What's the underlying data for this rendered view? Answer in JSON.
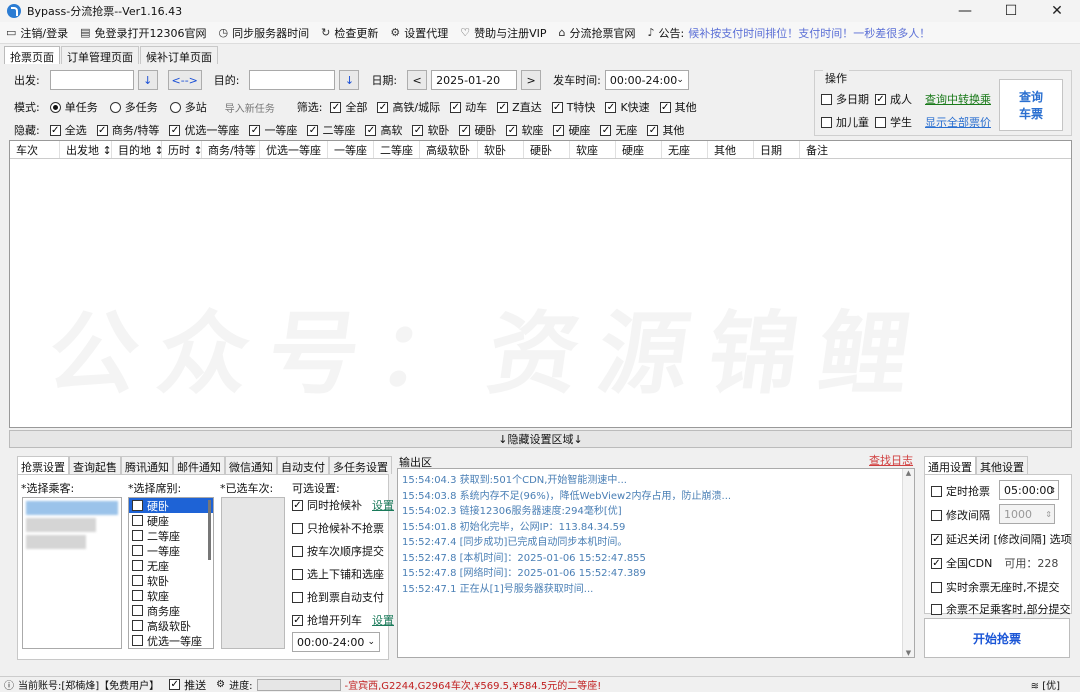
{
  "window": {
    "title": "Bypass-分流抢票--Ver1.16.43",
    "min": "—",
    "max": "☐",
    "close": "✕"
  },
  "menu": [
    {
      "icon": "▭",
      "label": "注销/登录"
    },
    {
      "icon": "▤",
      "label": "免登录打开12306官网"
    },
    {
      "icon": "◷",
      "label": "同步服务器时间"
    },
    {
      "icon": "↻",
      "label": "检查更新"
    },
    {
      "icon": "⚙",
      "label": "设置代理"
    },
    {
      "icon": "♡",
      "label": "赞助与注册VIP"
    },
    {
      "icon": "⌂",
      "label": "分流抢票官网"
    },
    {
      "icon": "♪",
      "label": "公告:"
    }
  ],
  "notice": "候补按支付时间排位！支付时间！一秒差很多人！",
  "tabs": [
    "抢票页面",
    "订单管理页面",
    "候补订单页面"
  ],
  "query": {
    "from_label": "出发:",
    "to_label": "目的:",
    "swap": "<-->",
    "date_label": "日期:",
    "date_value": "2025-01-20",
    "prev": "<",
    "next": ">",
    "time_label": "发车时间:",
    "time_value": "00:00-24:00",
    "dropdown": "↓"
  },
  "mode": {
    "label": "模式:",
    "single": "单任务",
    "multi": "多任务",
    "multistation": "多站",
    "import": "导入新任务",
    "filter_label": "筛选:",
    "filters": [
      "全部",
      "高铁/城际",
      "动车",
      "Z直达",
      "T特快",
      "K快速",
      "其他"
    ]
  },
  "hide": {
    "label": "隐藏:",
    "items": [
      "全选",
      "商务/特等",
      "优选一等座",
      "一等座",
      "二等座",
      "高软",
      "软卧",
      "硬卧",
      "软座",
      "硬座",
      "无座",
      "其他"
    ]
  },
  "ops": {
    "title": "操作",
    "multi_date": "多日期",
    "adult": "成人",
    "child": "加儿童",
    "student": "学生",
    "transfer": "查询中转换乘",
    "all_price": "显示全部票价",
    "query_btn_1": "查询",
    "query_btn_2": "车票"
  },
  "grid_columns": [
    "车次",
    "出发地 ↕",
    "目的地 ↕",
    "历时 ↕",
    "商务/特等",
    "优选一等座",
    "一等座",
    "二等座",
    "高级软卧",
    "软卧",
    "硬卧",
    "软座",
    "硬座",
    "无座",
    "其他",
    "日期",
    "备注"
  ],
  "watermark": "公众号：资源锦鲤",
  "hidebar": "↓隐藏设置区域↓",
  "bottom_tabs": [
    "抢票设置",
    "查询起售",
    "腾讯通知",
    "邮件通知",
    "微信通知",
    "自动支付",
    "多任务设置"
  ],
  "passengers_label": "*选择乘客:",
  "seats_label": "*选择席别:",
  "seats": [
    "硬卧",
    "硬座",
    "二等座",
    "一等座",
    "无座",
    "软卧",
    "软座",
    "商务座",
    "高级软卧",
    "优选一等座"
  ],
  "trains_label": "*已选车次:",
  "options": {
    "label": "可选设置:",
    "items": [
      {
        "text": "同时抢候补",
        "checked": true,
        "link": "设置"
      },
      {
        "text": "只抢候补不抢票",
        "checked": false,
        "link": ""
      },
      {
        "text": "按车次顺序提交",
        "checked": false,
        "link": ""
      },
      {
        "text": "选上下铺和选座",
        "checked": false,
        "link": ""
      },
      {
        "text": "抢到票自动支付",
        "checked": false,
        "link": ""
      },
      {
        "text": "抢增开列车",
        "checked": true,
        "link": "设置"
      }
    ],
    "time_value": "00:00-24:00"
  },
  "output": {
    "label": "输出区",
    "find_log": "查找日志",
    "logs": [
      "15:54:04.3  获取到:501个CDN,开始智能测速中...",
      "15:54:03.8  系统内存不足(96%)，降低WebView2内存占用，防止崩溃...",
      "15:54:02.3  链接12306服务器速度:294毫秒[优]",
      "15:54:01.8  初始化完毕，公网IP：113.84.34.59",
      "15:52:47.4  [同步成功]已完成自动同步本机时间。",
      "15:52:47.8  [本机时间]：2025-01-06 15:52:47.855",
      "15:52:47.8  [网络时间]：2025-01-06 15:52:47.389",
      "15:52:47.1  正在从[1]号服务器获取时间..."
    ]
  },
  "general": {
    "tabs": [
      "通用设置",
      "其他设置"
    ],
    "timed": "定时抢票",
    "timed_value": "05:00:00",
    "interval": "修改间隔",
    "interval_value": "1000",
    "delay": "延迟关闭 [修改间隔] 选项",
    "cdn": "全国CDN",
    "cdn_avail": "可用：228",
    "realtime": "实时余票无座时,不提交",
    "partial": "余票不足乘客时,部分提交",
    "start": "开始抢票"
  },
  "status": {
    "account": "当前账号:[郑楠烽]【免费用户】",
    "push": "推送",
    "progress": "进度:",
    "result": "-宜宾西,G2244,G2964车次,¥569.5,¥584.5元的二等座!",
    "right": "[优]"
  }
}
